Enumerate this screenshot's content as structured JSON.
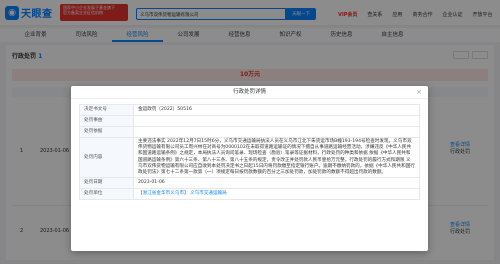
{
  "brand": {
    "name": "天眼查"
  },
  "promo": {
    "line1": "国家中小企业发展子基金旗下",
    "line2": "官方备案企业征信机构"
  },
  "search": {
    "value": "义乌市双伟货物运输有限公司",
    "button": "天眼一下"
  },
  "topnav": {
    "vip": "VIP会员",
    "items": [
      "查关系",
      "应用",
      "商务合作",
      "企业认证",
      "开放平台"
    ]
  },
  "tabs": [
    "企业背景",
    "司法风险",
    "经营风险",
    "公司发展",
    "经营信息",
    "知识产权",
    "历史信息",
    "自主信息"
  ],
  "tabs_active_index": 2,
  "section": {
    "title": "行政处罚",
    "count": "1",
    "amount": "10万元"
  },
  "rows": [
    {
      "num": "1",
      "date": "2023-01-06",
      "link": "查看详情",
      "dept": "行政处罚"
    },
    {
      "num": "2",
      "date": "2023-01-06",
      "link": "查看详情",
      "dept": "行政处罚"
    }
  ],
  "modal": {
    "title": "行政处罚详情",
    "close": "×",
    "fields": [
      {
        "key": "决定书文号",
        "value": "金运政罚（2022）50516"
      },
      {
        "key": "处罚事由",
        "value": ""
      },
      {
        "key": "处罚依据",
        "value": ""
      },
      {
        "key": "处罚内容",
        "value": "主要违法事实 2022年12月7日15时6分，义乌市交通运输局执法人员在义乌市江北下朱货运市场B幢193-194号检查时发现，义乌市双伟货物运输有限公司员工周兴林在对商号为0000102在未取得道路运输证的情况下擅自从事道路运输经营活动，涉嫌违反《中华人民共和国道路运输条例》之规定，本局执法人员询问笔录、现场检查（勘验）笔录等证据材料，行政处罚的种类和依据 依据《中华人民共和国道路运输条例》第六十三条、第八十三条、第八十五条的规定，责令改正并处罚款人民币壹拾万元整。行政处罚的履行方式和期限 义乌市双伟货物运输有限公司应自收到本处罚决定书之日起15日内将罚款缴至指定银行账户。逾期不缴纳罚款的，依据《中华人民共和国行政处罚法》第七十二条第一款第（一）项规定每日按罚款数额的百分之三加处罚款，加处罚款的数额不得超出罚款的数额。"
      },
      {
        "key": "处罚日期",
        "value": "2023-01-06"
      },
      {
        "key": "处罚单位",
        "value": "【浙江省金华市义乌市】 义乌市交通运输局"
      }
    ]
  }
}
